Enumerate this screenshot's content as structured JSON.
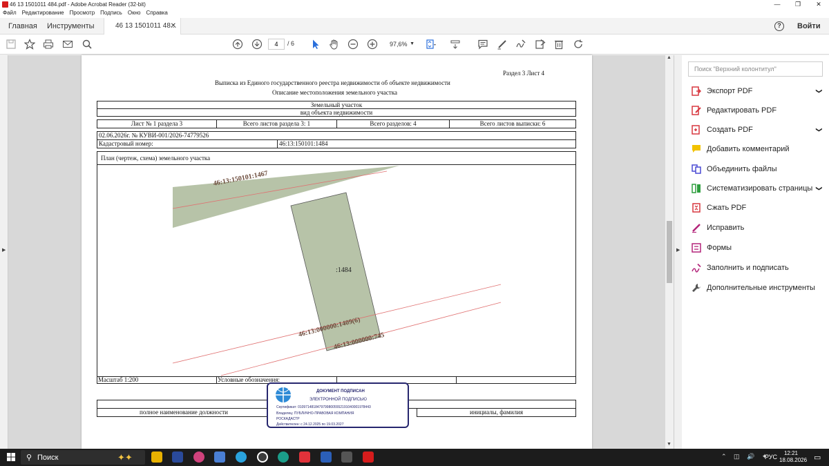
{
  "window": {
    "title": "46 13 1501011 484.pdf - Adobe Acrobat Reader (32-bit)",
    "minimize": "—",
    "maximize": "❐",
    "close": "✕"
  },
  "menu": [
    "Файл",
    "Редактирование",
    "Просмотр",
    "Подпись",
    "Окно",
    "Справка"
  ],
  "tabs": {
    "home": "Главная",
    "tools": "Инструменты",
    "doc": "46 13 1501011 48...",
    "doc_close": "✕",
    "help": "?",
    "login": "Войти"
  },
  "toolbar": {
    "page_current": "4",
    "page_total": "/ 6",
    "zoom": "97,6%"
  },
  "document": {
    "section": "Раздел 3    Лист 4",
    "heading1": "Выписка из Единого государственного реестра недвижимости об объекте недвижимости",
    "heading2": "Описание местоположения земельного участка",
    "object": "Земельный участок",
    "object_kind": "вид объекта недвижимости",
    "sheet_no": "Лист № 1 раздела 3",
    "sheets_section": "Всего листов раздела 3: 1",
    "sections_total": "Всего разделов: 4",
    "sheets_total": "Всего листов выписки: 6",
    "date_no": "02.06.2026г. № КУВИ-001/2026-74779526",
    "cadastral_label": "Кадастровый номер:",
    "cadastral_value": "46:13:150101:1484",
    "plan_title": "План (чертеж, схема) земельного участка",
    "plot_label_top": "46:13:150101:1467",
    "plot_label_main": ":1484",
    "plot_label_road": "46:13:000000:1409(6)",
    "plot_label_road2": "46:13:000000:745",
    "scale": "Масштаб 1:200",
    "legend": "Условные обозначения:",
    "position_label": "полное наименование должности",
    "initials_label": "инициалы, фамилия"
  },
  "stamp": {
    "line1": "ДОКУМЕНТ ПОДПИСАН",
    "line2": "ЭЛЕКТРОННОЙ ПОДПИСЬЮ",
    "cert": "Сертификат: 01097148184797998005552191040001978443",
    "owner": "Владелец: ПУБЛИЧНО-ПРАВОВАЯ КОМПАНИЯ",
    "owner2": "РОСКАДАСТР",
    "valid": "Действителен: с 24.12.2025 по 19.03.2027"
  },
  "pane": {
    "search_placeholder": "Поиск \"Верхний колонтитул\"",
    "items": [
      {
        "label": "Экспорт PDF",
        "color": "#d7373f",
        "chevron": true
      },
      {
        "label": "Редактировать PDF",
        "color": "#d7373f",
        "chevron": false
      },
      {
        "label": "Создать PDF",
        "color": "#d7373f",
        "chevron": true
      },
      {
        "label": "Добавить комментарий",
        "color": "#e6b800",
        "chevron": false
      },
      {
        "label": "Объединить файлы",
        "color": "#4a4ad4",
        "chevron": false
      },
      {
        "label": "Систематизировать страницы",
        "color": "#2e9e3e",
        "chevron": true
      },
      {
        "label": "Сжать PDF",
        "color": "#d7373f",
        "chevron": false
      },
      {
        "label": "Исправить",
        "color": "#b3247a",
        "chevron": false
      },
      {
        "label": "Формы",
        "color": "#b3247a",
        "chevron": false
      },
      {
        "label": "Заполнить и подписать",
        "color": "#b3247a",
        "chevron": false
      },
      {
        "label": "Дополнительные инструменты",
        "color": "#555555",
        "chevron": false
      }
    ],
    "chevron_glyph": "❯"
  },
  "taskbar": {
    "search": "Поиск",
    "lang": "РУС",
    "time": "12:21",
    "date": "18.08.2026",
    "tray": "⌃ ◫ 🔊 ✦"
  }
}
